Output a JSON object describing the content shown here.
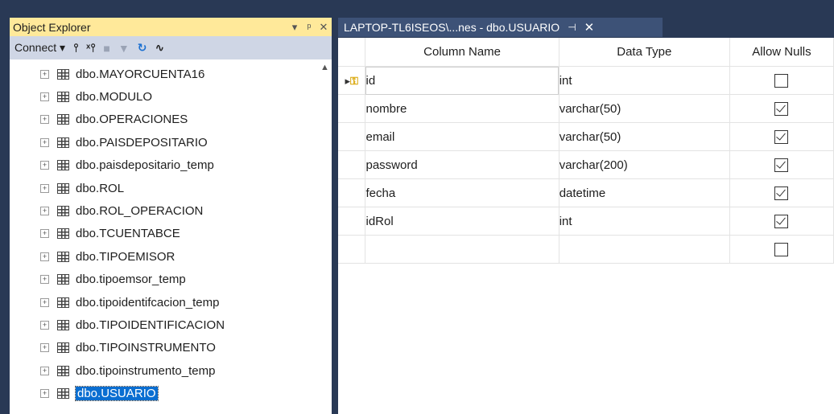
{
  "object_explorer": {
    "title": "Object Explorer",
    "title_buttons": [
      "▾",
      "ᵖ",
      "✕"
    ],
    "toolbar": {
      "connect_label": "Connect ▾",
      "icons": [
        "connect-plug-icon",
        "disconnect-plug-icon",
        "stop-icon",
        "filter-icon",
        "refresh-icon",
        "activity-monitor-icon"
      ]
    },
    "tree_items": [
      {
        "label": "dbo.MAYORCUENTA16",
        "selected": false
      },
      {
        "label": "dbo.MODULO",
        "selected": false
      },
      {
        "label": "dbo.OPERACIONES",
        "selected": false
      },
      {
        "label": "dbo.PAISDEPOSITARIO",
        "selected": false
      },
      {
        "label": "dbo.paisdepositario_temp",
        "selected": false
      },
      {
        "label": "dbo.ROL",
        "selected": false
      },
      {
        "label": "dbo.ROL_OPERACION",
        "selected": false
      },
      {
        "label": "dbo.TCUENTABCE",
        "selected": false
      },
      {
        "label": "dbo.TIPOEMISOR",
        "selected": false
      },
      {
        "label": "dbo.tipoemsor_temp",
        "selected": false
      },
      {
        "label": "dbo.tipoidentifcacion_temp",
        "selected": false
      },
      {
        "label": "dbo.TIPOIDENTIFICACION",
        "selected": false
      },
      {
        "label": "dbo.TIPOINSTRUMENTO",
        "selected": false
      },
      {
        "label": "dbo.tipoinstrumento_temp",
        "selected": false
      },
      {
        "label": "dbo.USUARIO",
        "selected": true
      }
    ]
  },
  "document_tab": {
    "title": "LAPTOP-TL6ISEOS\\...nes - dbo.USUARIO",
    "pin_glyph": "⊣",
    "close_glyph": "✕"
  },
  "design_grid": {
    "headers": {
      "column_name": "Column Name",
      "data_type": "Data Type",
      "allow_nulls": "Allow Nulls"
    },
    "rows": [
      {
        "name": "id",
        "type": "int",
        "nulls": false,
        "primary_key": true
      },
      {
        "name": "nombre",
        "type": "varchar(50)",
        "nulls": true,
        "primary_key": false
      },
      {
        "name": "email",
        "type": "varchar(50)",
        "nulls": true,
        "primary_key": false
      },
      {
        "name": "password",
        "type": "varchar(200)",
        "nulls": true,
        "primary_key": false
      },
      {
        "name": "fecha",
        "type": "datetime",
        "nulls": true,
        "primary_key": false
      },
      {
        "name": "idRol",
        "type": "int",
        "nulls": true,
        "primary_key": false
      },
      {
        "name": "",
        "type": "",
        "nulls": false,
        "primary_key": false
      }
    ]
  },
  "colors": {
    "frame_bg": "#293955",
    "title_active": "#ffe99a",
    "tab_bg": "#3d5277",
    "selection": "#0a6ed1"
  }
}
